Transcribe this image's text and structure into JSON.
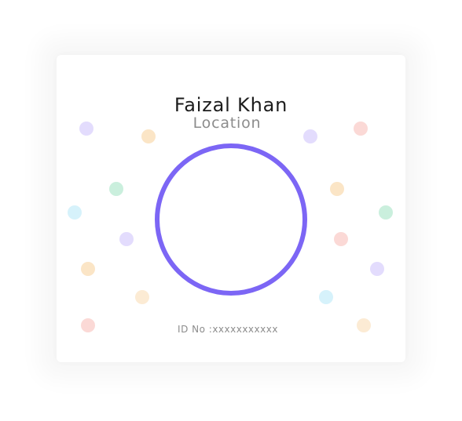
{
  "profile": {
    "name": "Faizal Khan",
    "location": "Location",
    "id_line": "ID No :xxxxxxxxxxx"
  },
  "colors": {
    "ring": "#7c66f5",
    "dot_palette": [
      "#e3dcfd",
      "#fbe5c6",
      "#caefdd",
      "#d6f2fb",
      "#fbd9d6",
      "#fcebd4"
    ]
  },
  "decorations": {
    "left_dots": [
      "#e3dcfd",
      "#fbe5c6",
      "#caefdd",
      "#d6f2fb",
      "#e3dcfd",
      "#fbe5c6",
      "#fcebd4",
      "#fbd9d6"
    ],
    "right_dots": [
      "#e3dcfd",
      "#fbd9d6",
      "#fbe5c6",
      "#caefdd",
      "#fbd9d6",
      "#e3dcfd",
      "#d6f2fb",
      "#fcebd4"
    ]
  }
}
